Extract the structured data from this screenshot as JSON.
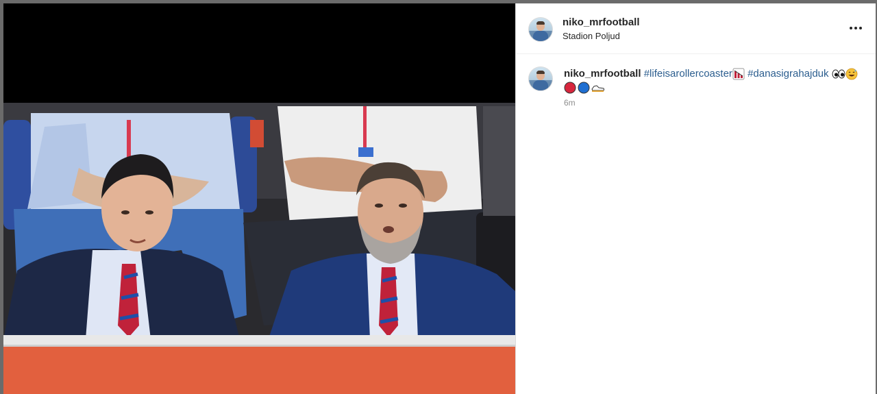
{
  "post": {
    "username": "niko_mrfootball",
    "location": "Stadion Poljud",
    "photo_alt": "Two men in navy suits with red and blue striped ties seated in stadium stands",
    "caption": {
      "username": "niko_mrfootball",
      "hashtag_1": "#lifeisarollercoaster",
      "hashtag_2": "#danasigrahajduk"
    },
    "emoji": {
      "chart": "chart-decreasing-icon",
      "eyes": "eyes-icon",
      "smile": "grinning-sweat-icon",
      "red": "red-circle-icon",
      "blue": "blue-circle-icon",
      "shoe": "sneaker-icon"
    },
    "time_ago": "6m"
  },
  "colors": {
    "hashtag": "#2b5d8e",
    "text": "#262626",
    "muted": "#8e8e8e",
    "accent_red": "#d7263d",
    "accent_blue": "#1f6fd1"
  }
}
